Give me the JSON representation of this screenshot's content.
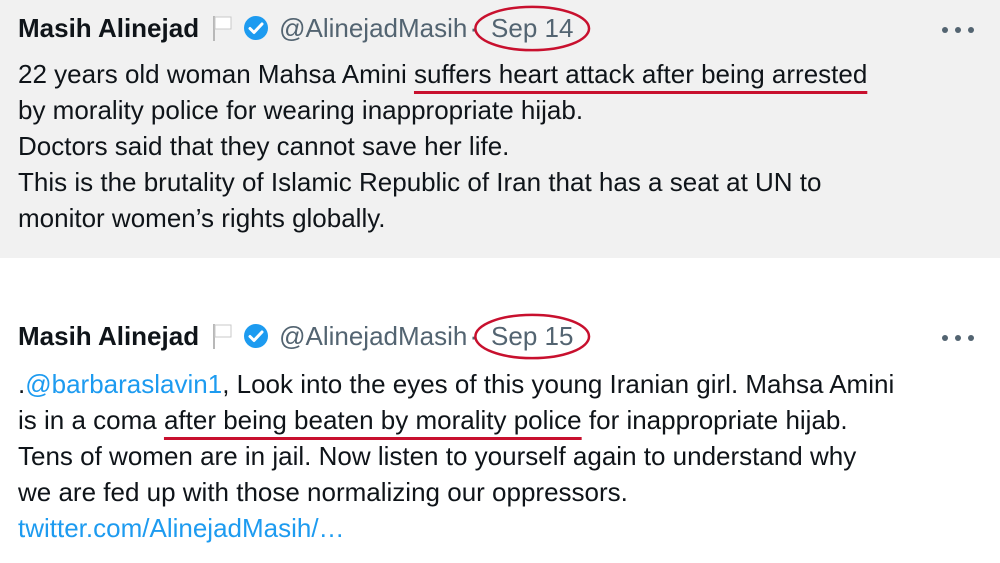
{
  "tweets": [
    {
      "author_name": "Masih Alinejad",
      "handle": "@AlinejadMasih",
      "separator": "·",
      "date": "Sep 14",
      "more_icon": "more-horizontal-icon",
      "lines": [
        {
          "before": "22 years old woman Mahsa Amini ",
          "highlight": "suffers heart attack after being arrested"
        },
        {
          "text": "by morality police for wearing inappropriate hijab."
        },
        {
          "text": "Doctors said that they cannot save her life."
        },
        {
          "text": "This is the brutality of Islamic Republic of Iran that has a seat at UN to"
        },
        {
          "text": "monitor women’s rights globally."
        }
      ]
    },
    {
      "author_name": "Masih Alinejad",
      "handle": "@AlinejadMasih",
      "separator": "·",
      "date": "Sep 15",
      "more_icon": "more-horizontal-icon",
      "lines": [
        {
          "prefix": ".",
          "mention": "@barbaraslavin1",
          "after": ", Look into the eyes of this young Iranian girl. Mahsa Amini"
        },
        {
          "before": "is in a coma ",
          "highlight": "after being beaten by morality police",
          "after": " for inappropriate hijab."
        },
        {
          "text": "Tens of women are in jail. Now listen to yourself again to understand why"
        },
        {
          "text": "we are fed up with those normalizing our oppressors."
        }
      ],
      "link": "twitter.com/AlinejadMasih/…"
    }
  ],
  "colors": {
    "annotation_red": "#c8102e",
    "twitter_blue": "#1d9bf0",
    "secondary_gray": "#536471",
    "highlight_bg": "#f1f1f1"
  }
}
